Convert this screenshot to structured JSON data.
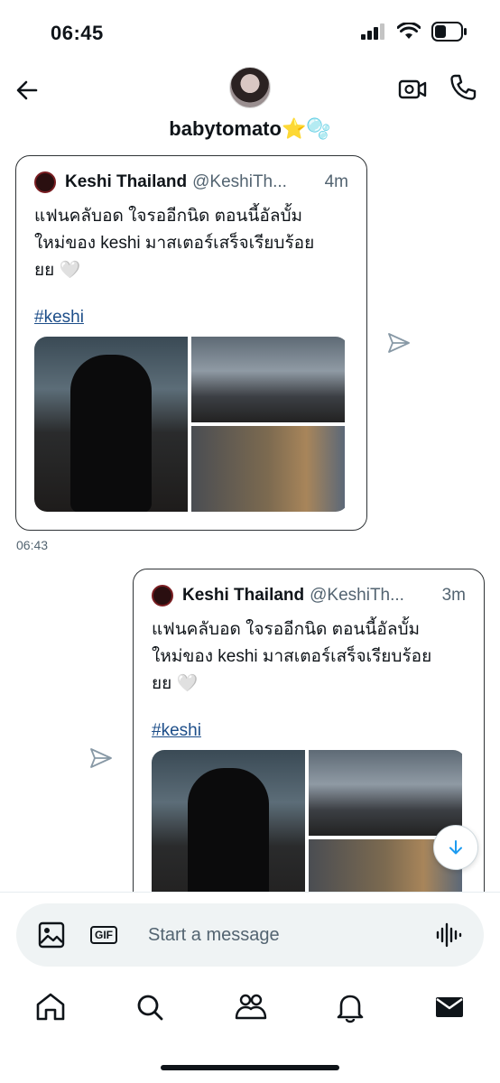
{
  "status_bar": {
    "time": "06:45",
    "icons": [
      "cellular-signal-icon",
      "wifi-icon",
      "battery-icon"
    ]
  },
  "header": {
    "contact_name": "babytomato⭐️🫧",
    "icons": [
      "back-arrow-icon",
      "avatar",
      "video-call-icon",
      "phone-icon"
    ]
  },
  "messages": [
    {
      "author_name": "Keshi Thailand",
      "author_handle": "@KeshiTh...",
      "time": "4m",
      "text": "แฟนคลับอด ใจรออีกนิด ตอนนี้อัลบั้ม\nใหม่ของ keshi มาสเตอร์เสร็จเรียบร้อย\nยย 🤍",
      "hashtag": "#keshi",
      "timestamp": "06:43"
    },
    {
      "author_name": "Keshi Thailand",
      "author_handle": "@KeshiTh...",
      "time": "3m",
      "text": "แฟนคลับอด ใจรออีกนิด ตอนนี้อัลบั้ม\nใหม่ของ keshi มาสเตอร์เสร็จเรียบร้อย\nยย 🤍",
      "hashtag": "#keshi"
    }
  ],
  "composer": {
    "placeholder": "Start a message",
    "gif_label": "GIF"
  },
  "nav": [
    "home-icon",
    "search-icon",
    "communities-icon",
    "notifications-icon",
    "messages-icon"
  ],
  "colors": {
    "text": "#0f1419",
    "secondary": "#536471",
    "link": "#1d4e89",
    "accent": "#1d9bf0"
  }
}
